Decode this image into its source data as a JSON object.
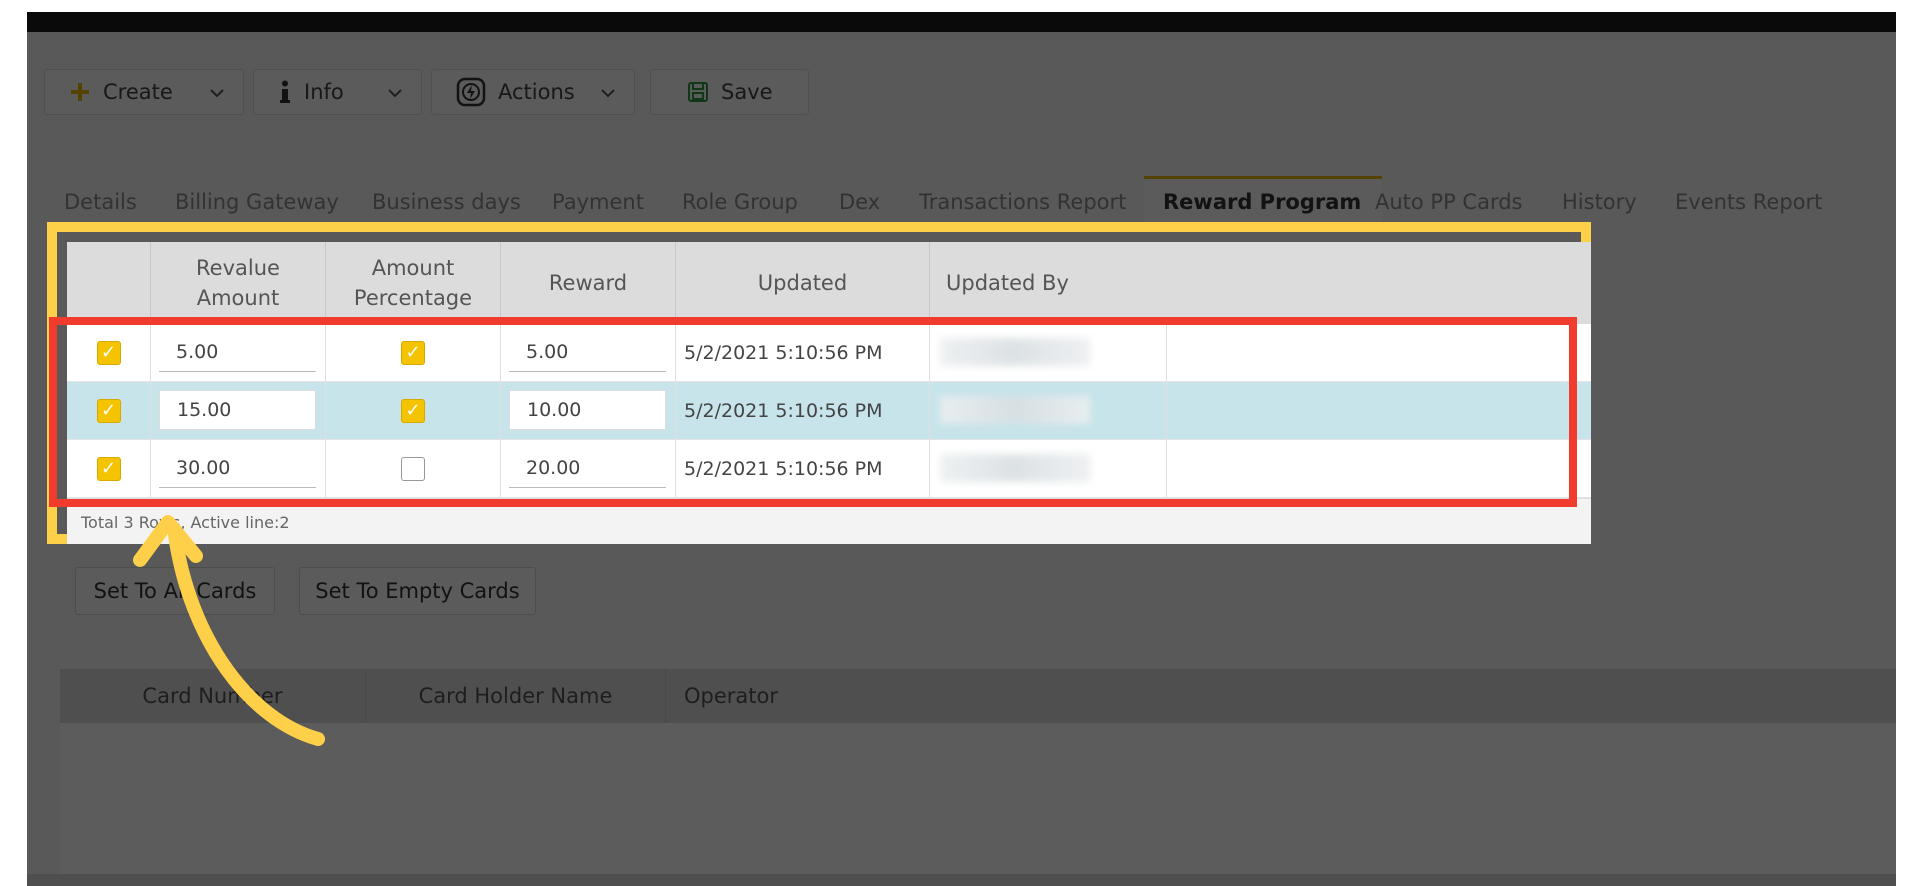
{
  "toolbar": {
    "create_label": "Create",
    "info_label": "Info",
    "actions_label": "Actions",
    "save_label": "Save"
  },
  "tabs": [
    {
      "label": "Details"
    },
    {
      "label": "Billing Gateway"
    },
    {
      "label": "Business days"
    },
    {
      "label": "Payment"
    },
    {
      "label": "Role Group"
    },
    {
      "label": "Dex"
    },
    {
      "label": "Transactions Report"
    },
    {
      "label": "Reward Program",
      "active": true
    },
    {
      "label": "Auto PP Cards"
    },
    {
      "label": "History"
    },
    {
      "label": "Events Report"
    }
  ],
  "reward_grid": {
    "columns": {
      "revalue_amount_l1": "Revalue",
      "revalue_amount_l2": "Amount",
      "amount_percentage_l1": "Amount",
      "amount_percentage_l2": "Percentage",
      "reward": "Reward",
      "updated": "Updated",
      "updated_by": "Updated By"
    },
    "rows": [
      {
        "selected": true,
        "revalue_amount": "5.00",
        "amount_percentage": true,
        "reward": "5.00",
        "updated": "5/2/2021 5:10:56 PM"
      },
      {
        "selected": true,
        "revalue_amount": "15.00",
        "amount_percentage": true,
        "reward": "10.00",
        "updated": "5/2/2021 5:10:56 PM",
        "active": true
      },
      {
        "selected": true,
        "revalue_amount": "30.00",
        "amount_percentage": false,
        "reward": "20.00",
        "updated": "5/2/2021 5:10:56 PM"
      }
    ],
    "footer": "Total 3 Rows, Active line:2"
  },
  "buttons": {
    "set_all_cards": "Set To All Cards",
    "set_empty_cards": "Set To Empty Cards"
  },
  "cards_grid": {
    "columns": {
      "card_number": "Card Number",
      "card_holder_name": "Card Holder Name",
      "operator": "Operator"
    }
  },
  "colors": {
    "highlight_yellow": "#fecf48",
    "highlight_red": "#f23b2f",
    "checkbox_yellow": "#f4c400",
    "active_row": "#c6e4ea"
  }
}
